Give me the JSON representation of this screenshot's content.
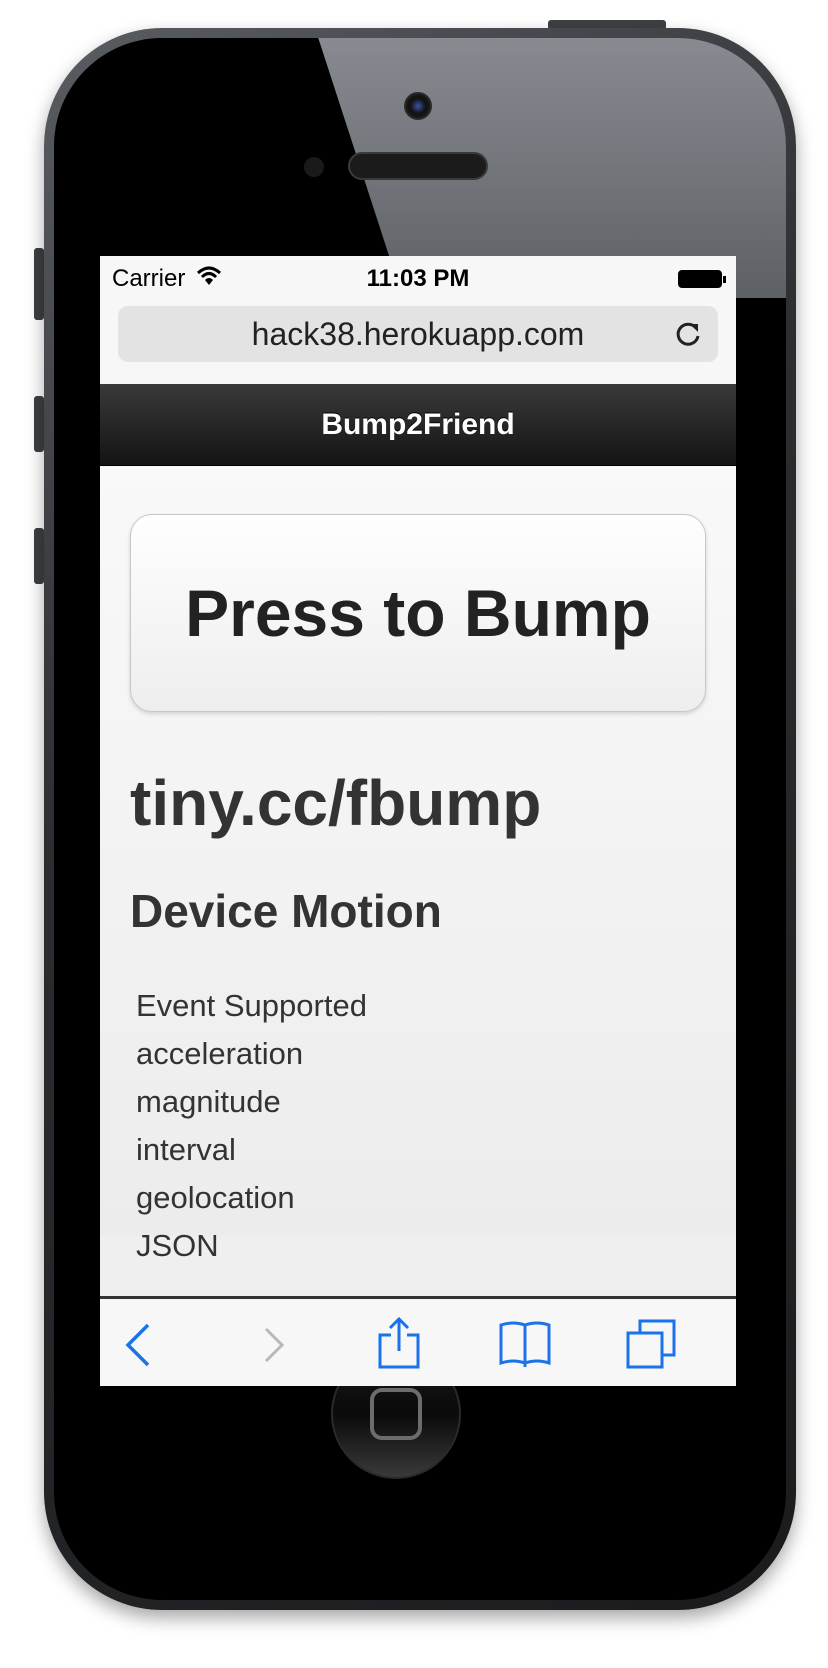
{
  "status_bar": {
    "carrier": "Carrier",
    "time": "11:03 PM"
  },
  "browser": {
    "url": "hack38.herokuapp.com",
    "accent_color": "#1a73e8"
  },
  "app": {
    "title": "Bump2Friend",
    "bump_button_label": "Press to Bump",
    "short_link": "tiny.cc/fbump",
    "section_title": "Device Motion",
    "motion_items": [
      "Event Supported",
      "acceleration",
      "magnitude",
      "interval",
      "geolocation",
      "JSON"
    ]
  },
  "toolbar": {
    "icons": [
      "back-icon",
      "forward-icon",
      "share-icon",
      "bookmarks-icon",
      "tabs-icon"
    ]
  }
}
